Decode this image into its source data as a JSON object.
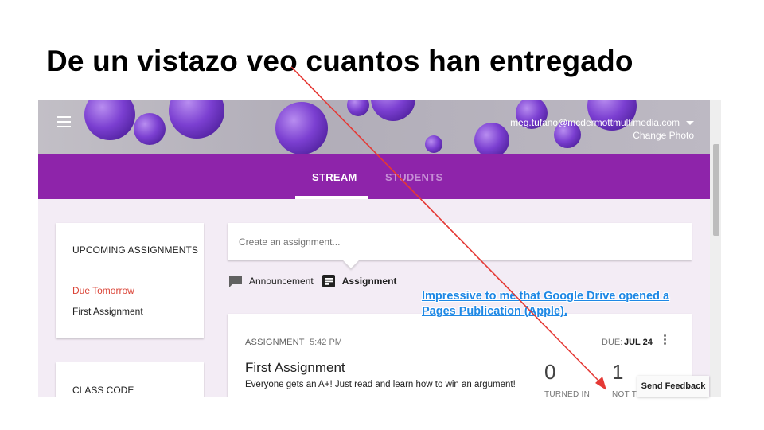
{
  "slide": {
    "title": "De un vistazo veo cuantos han entregado",
    "annotation_line1": "Impressive to me that Google Drive opened a",
    "annotation_line2": "Pages Publication (Apple).",
    "arrow_color": "#e53935"
  },
  "header": {
    "account_email": "meg.tufano@mcdermottmultimedia.com",
    "change_photo": "Change Photo",
    "menu_icon": "hamburger-icon"
  },
  "tabs": {
    "stream": "STREAM",
    "students": "STUDENTS",
    "active": "STREAM"
  },
  "sidebar": {
    "upcoming_heading": "UPCOMING ASSIGNMENTS",
    "due_label": "Due Tomorrow",
    "upcoming_item": "First Assignment",
    "class_code_heading": "CLASS CODE"
  },
  "composer": {
    "placeholder": "Create an assignment...",
    "announcement_label": "Announcement",
    "assignment_label": "Assignment"
  },
  "assignment": {
    "type_label": "ASSIGNMENT",
    "time": "5:42 PM",
    "due_prefix": "DUE:",
    "due_date": "JUL 24",
    "title": "First Assignment",
    "description": "Everyone gets an A+!  Just read and learn how to win an argument!",
    "turned_in_count": "0",
    "turned_in_label": "TURNED IN",
    "not_turned_in_count": "1",
    "not_turned_in_label": "NOT TU"
  },
  "feedback": {
    "label": "Send Feedback"
  },
  "colors": {
    "accent": "#8e24aa",
    "due_red": "#db4437",
    "annotation_blue": "#1e88e5"
  }
}
